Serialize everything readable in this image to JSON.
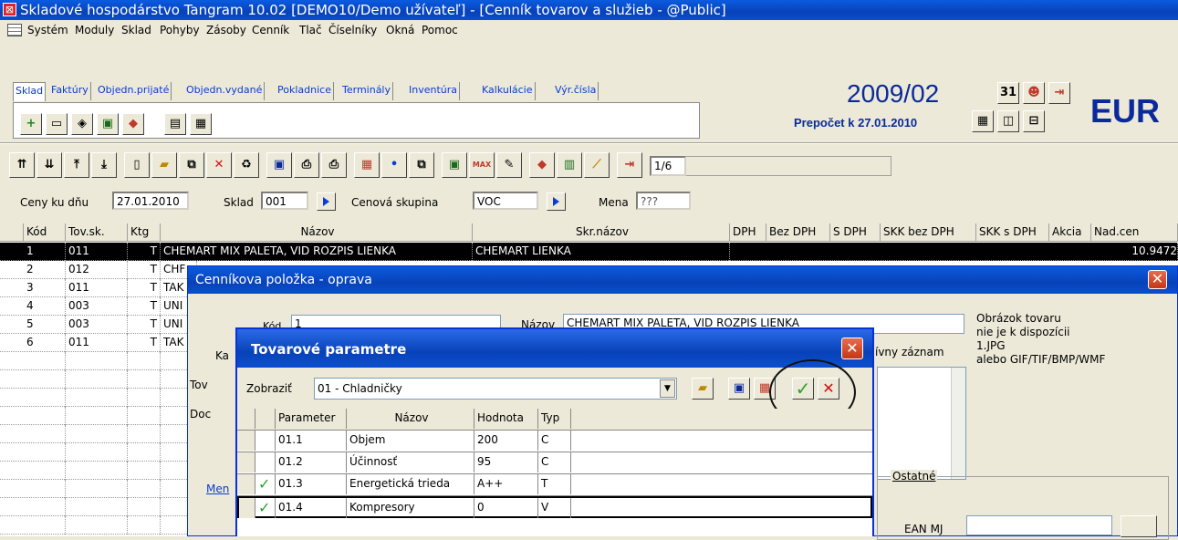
{
  "window": {
    "title": "Skladové hospodárstvo Tangram 10.02 [DEMO10/Demo užívateľ] - [Cenník tovarov a služieb - @Public]"
  },
  "menu": [
    "Systém",
    "Moduly",
    "Sklad",
    "Pohyby",
    "Zásoby",
    "Cenník",
    "Tlač",
    "Číselníky",
    "Okná",
    "Pomoc"
  ],
  "tabs": [
    {
      "label": "Sklad",
      "active": true
    },
    {
      "label": "Faktúry"
    },
    {
      "label": "Objedn.prijaté"
    },
    {
      "label": "Objedn.vydané"
    },
    {
      "label": "Pokladnice"
    },
    {
      "label": "Terminály"
    },
    {
      "label": "Inventúra"
    },
    {
      "label": "Kalkulácie"
    },
    {
      "label": "Výr.čísla"
    }
  ],
  "period": "2009/02",
  "currency": "EUR",
  "prepocet": "Prepočet k 27.01.2010",
  "record_counter": "1/6",
  "filters": {
    "ceny_label": "Ceny ku dňu",
    "ceny_value": "27.01.2010",
    "sklad_label": "Sklad",
    "sklad_value": "001",
    "cenova_label": "Cenová skupina",
    "cenova_value": "VOC",
    "mena_label": "Mena",
    "mena_value": "???"
  },
  "grid": {
    "headers": [
      "Kód",
      "Tov.sk.",
      "Ktg",
      "Názov",
      "Skr.názov",
      "DPH",
      "Bez DPH",
      "S DPH",
      "SKK bez DPH",
      "SKK s DPH",
      "Akcia",
      "Nad.cen"
    ],
    "rows": [
      {
        "kod": "1",
        "tovsk": "011",
        "ktg": "T",
        "nazov": "CHEMART MIX PALETA, VID ROZPIS       LIENKA",
        "skr": "CHEMART LIENKA",
        "nad": "10.9472"
      },
      {
        "kod": "2",
        "tovsk": "012",
        "ktg": "T",
        "nazov": "CHF"
      },
      {
        "kod": "3",
        "tovsk": "011",
        "ktg": "T",
        "nazov": "TAK"
      },
      {
        "kod": "4",
        "tovsk": "003",
        "ktg": "T",
        "nazov": "UNI"
      },
      {
        "kod": "5",
        "tovsk": "003",
        "ktg": "T",
        "nazov": "UNI"
      },
      {
        "kod": "6",
        "tovsk": "011",
        "ktg": "T",
        "nazov": "TAK"
      }
    ]
  },
  "dialog1": {
    "title": "Cenníkova položka - oprava",
    "kod_label": "Kód",
    "kod_value": "1",
    "nazov_label": "Názov",
    "nazov_value": "CHEMART MIX PALETA, VID ROZPIS       LIENKA",
    "ka_label": "Ka",
    "tov_label": "Tov",
    "doc_label": "Doc",
    "men_label": "Men",
    "aktivny": "ívny záznam",
    "obrazok_lines": [
      "Obrázok tovaru",
      "nie je k dispozícii",
      "1.JPG",
      "alebo GIF/TIF/BMP/WMF"
    ],
    "ostatne_label": "Ostatné",
    "ean_label": "EAN MJ"
  },
  "dialog2": {
    "title": "Tovarové parametre",
    "zobrazit_label": "Zobraziť",
    "zobrazit_value": "01 - Chladničky",
    "headers": [
      "Parameter",
      "Názov",
      "Hodnota",
      "Typ"
    ],
    "rows": [
      {
        "check": "",
        "param": "01.1",
        "nazov": "Objem",
        "hodnota": "200",
        "typ": "C"
      },
      {
        "check": "",
        "param": "01.2",
        "nazov": "Účinnosť",
        "hodnota": "95",
        "typ": "C"
      },
      {
        "check": "✓",
        "param": "01.3",
        "nazov": "Energetická trieda",
        "hodnota": "A++",
        "typ": "T"
      },
      {
        "check": "✓",
        "param": "01.4",
        "nazov": "Kompresory",
        "hodnota": "0",
        "typ": "V"
      }
    ]
  },
  "colors": {
    "titlebar": "#0842b8",
    "accent_text": "#0a2a9c",
    "tab_text": "#0a3bd6",
    "check": "#2da02d",
    "close": "#c43714"
  }
}
